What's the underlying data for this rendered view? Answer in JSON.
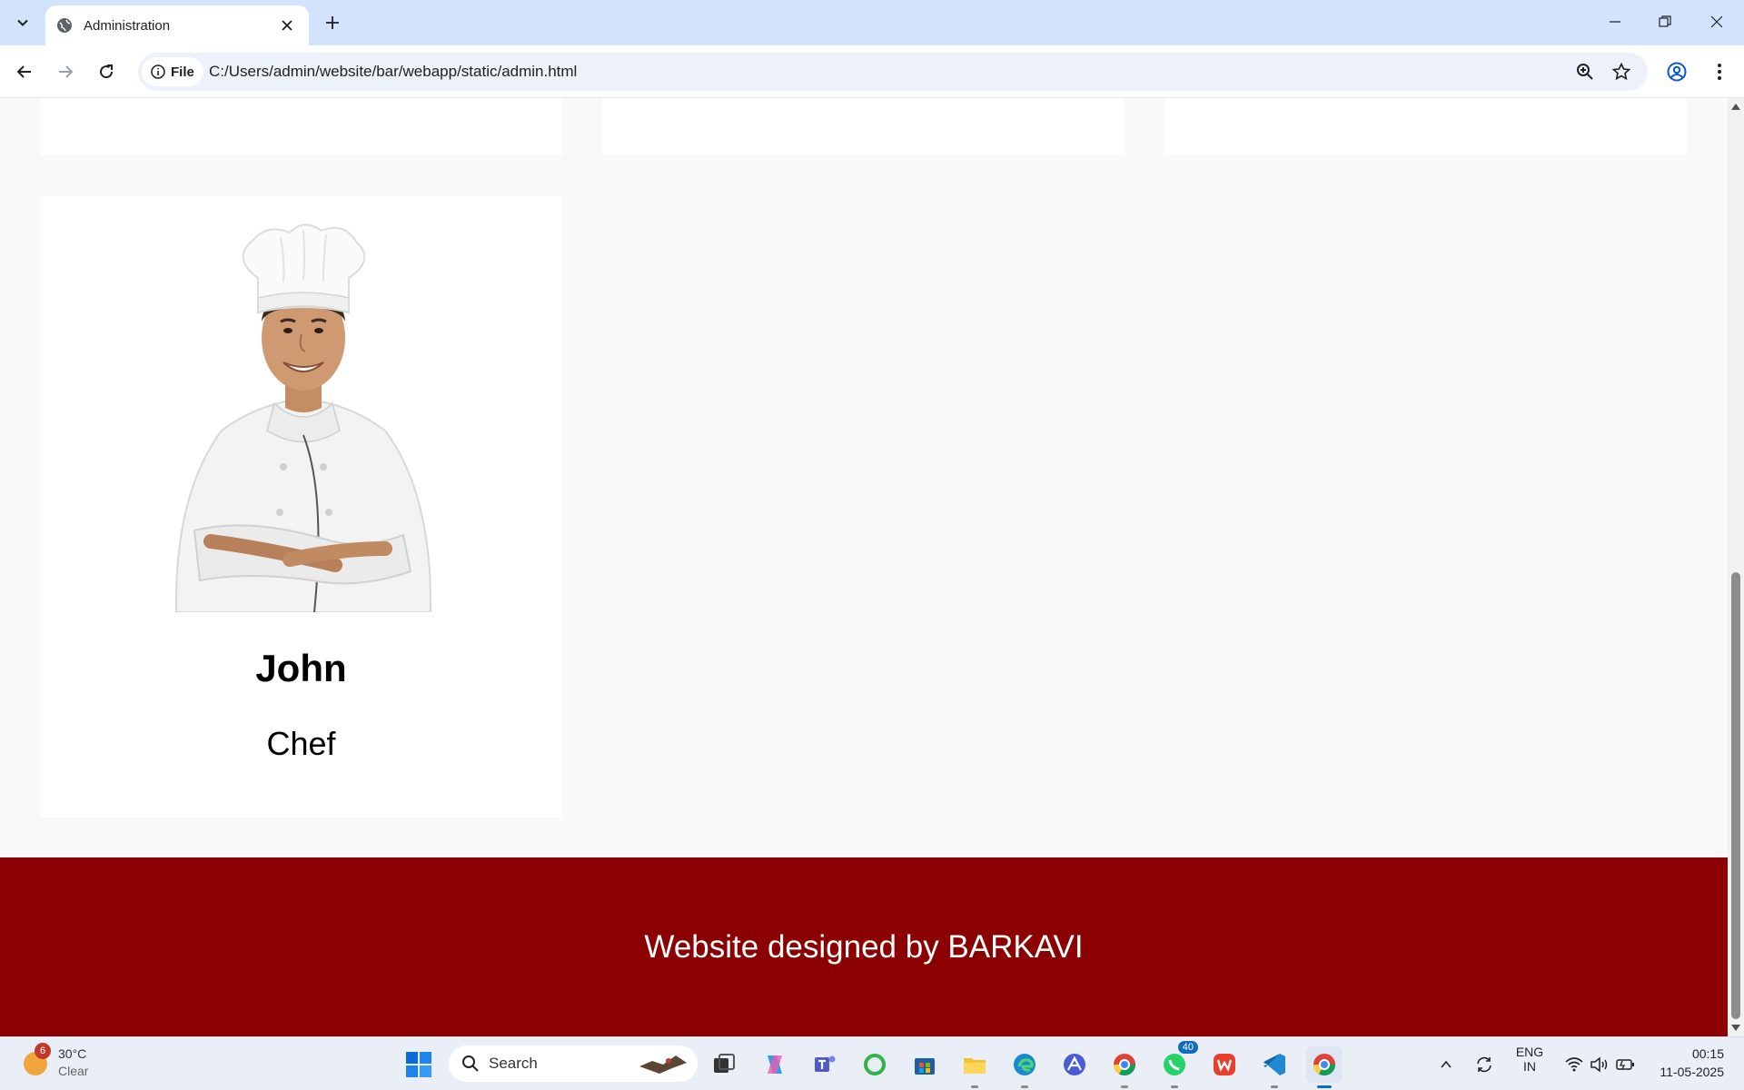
{
  "browser": {
    "tab_title": "Administration",
    "address_chip": "File",
    "url": "C:/Users/admin/website/bar/webapp/static/admin.html"
  },
  "page": {
    "staff": [
      {
        "name": "John",
        "role": "Chef"
      }
    ],
    "footer_text": "Website designed by BARKAVI",
    "footer_color": "#8b0000"
  },
  "taskbar": {
    "weather": {
      "temp": "30°C",
      "condition": "Clear",
      "badge": "6"
    },
    "search_label": "Search",
    "whatsapp_badge": "40",
    "language": {
      "line1": "ENG",
      "line2": "IN"
    },
    "time": "00:15",
    "date": "11-05-2025"
  }
}
